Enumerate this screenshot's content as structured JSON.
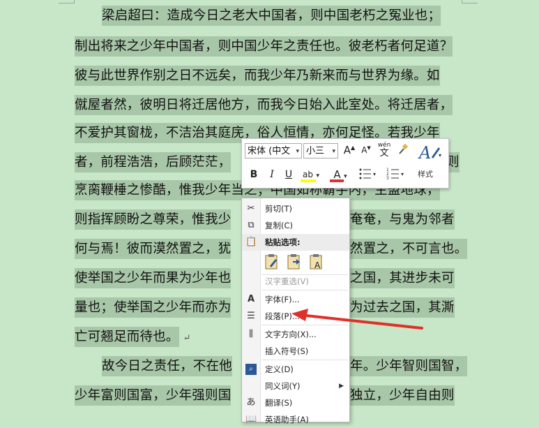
{
  "document": {
    "lines": [
      {
        "text": "梁启超曰：造成今日之老大中国者，则中国老朽之冤业也；"
      },
      {
        "text": "制出将来之少年中国者，则中国少年之责任也。彼老朽者何足道？"
      },
      {
        "text": "彼与此世界作别之日不远矣，而我少年乃新来而与世界为缘。如"
      },
      {
        "text": "僦屋者然，彼明日将迁居他方，而我今日始入此室处。将迁居者，"
      },
      {
        "text": "不爱护其窗栊，不洁治其庭庑，俗人恒情，亦何足怪。若我少年"
      },
      {
        "text": "者，前程浩浩，后顾茫茫，"
      },
      {
        "text": "烹脔鞭棰之惨酷，惟我少年当之；中国如称霸宇内，主盟地球，"
      },
      {
        "text": "则指挥顾盼之尊荣，惟我少"
      },
      {
        "text": "何与焉！彼而漠然置之，犹"
      },
      {
        "text": "使举国之少年而果为少年也"
      },
      {
        "text": "量也；使举国之少年而亦为"
      },
      {
        "text": "亡可翘足而待也。"
      },
      {
        "text": "故今日之责任，不在他"
      },
      {
        "text": "少年富则国富，少年强则国"
      }
    ],
    "right_fragments": [
      {
        "text": "则"
      },
      {
        "text": "奄奄，与鬼为邻者"
      },
      {
        "text": "然置之，不可言也。"
      },
      {
        "text": "之国，其进步未可"
      },
      {
        "text": "为过去之国，其澌"
      },
      {
        "text": "年。少年智则国智，"
      },
      {
        "text": "独立，少年自由则"
      }
    ],
    "paragraph_mark": "↵"
  },
  "mini_toolbar": {
    "font_name": "宋体 (中文",
    "font_size": "小三",
    "grow_font": "A",
    "shrink_font": "A",
    "phonetic": "wén",
    "bold": "B",
    "italic": "I",
    "underline": "U",
    "highlight": "ab",
    "font_color": "A",
    "styles_label": "样式"
  },
  "context_menu": {
    "items": [
      {
        "label": "剪切(T)",
        "icon": "scissors-icon"
      },
      {
        "label": "复制(C)",
        "icon": "copy-icon"
      },
      {
        "label": "粘贴选项:",
        "icon": "clipboard-icon"
      },
      {
        "label": "汉字重选(V)",
        "icon": ""
      },
      {
        "label": "字体(F)...",
        "icon": "font-icon"
      },
      {
        "label": "段落(P)...",
        "icon": "paragraph-icon"
      },
      {
        "label": "文字方向(X)...",
        "icon": "text-direction-icon"
      },
      {
        "label": "插入符号(S)",
        "icon": ""
      },
      {
        "label": "定义(D)",
        "icon": "search-icon"
      },
      {
        "label": "同义词(Y)",
        "icon": ""
      },
      {
        "label": "翻译(S)",
        "icon": "translate-icon"
      },
      {
        "label": "英语助手(A)",
        "icon": "dictionary-icon"
      }
    ]
  },
  "colors": {
    "background": "#c8e6c8",
    "selection": "#a8c6a8",
    "arrow": "#e0302a",
    "font_color_bar": "#e03030",
    "highlight_bar": "#ffff00"
  }
}
